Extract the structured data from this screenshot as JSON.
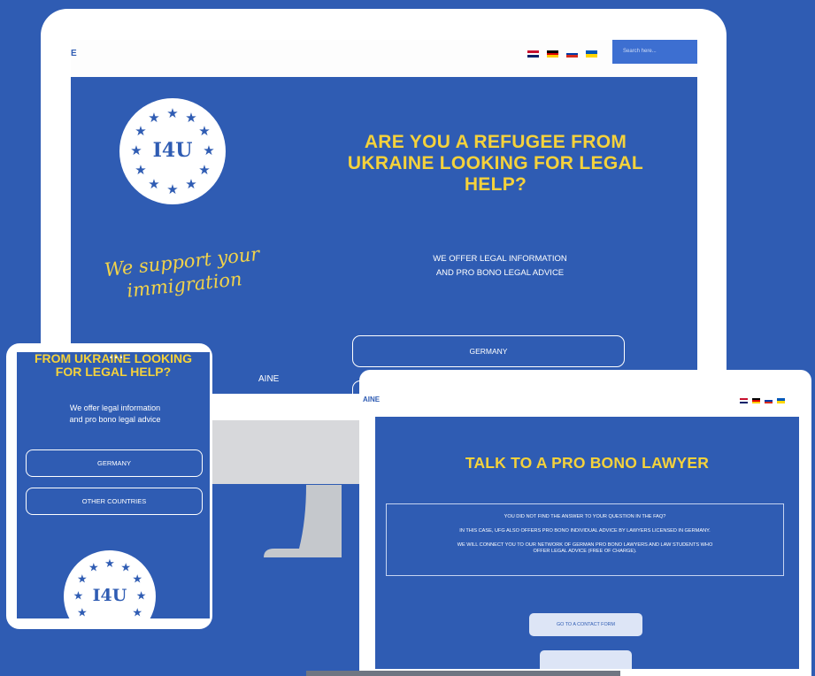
{
  "desktop": {
    "brand_cut": "E",
    "search": {
      "placeholder": "Search here..."
    },
    "flags": [
      "united-kingdom-flag",
      "germany-flag",
      "russia-flag",
      "ukraine-flag"
    ],
    "logo": {
      "text": "I4U"
    },
    "heading": "ARE YOU A REFUGEE FROM UKRAINE LOOKING FOR LEGAL HELP?",
    "script_text": "We support your immigration",
    "subheading_line1": "WE OFFER LEGAL INFORMATION",
    "subheading_line2": "AND PRO BONO LEGAL ADVICE",
    "button_germany": "GERMANY",
    "ukraine_cut": "AINE"
  },
  "tablet": {
    "dots": "•••",
    "heading_line1": "FROM UKRAINE LOOKING",
    "heading_line2": "FOR LEGAL HELP?",
    "sub_line1": "We offer legal information",
    "sub_line2": "and pro bono legal advice",
    "button_germany": "GERMANY",
    "button_other": "OTHER COUNTRIES",
    "logo_text": "I4U"
  },
  "laptop": {
    "brand_cut": "AINE",
    "flags": [
      "united-kingdom-flag",
      "germany-flag",
      "russia-flag",
      "ukraine-flag"
    ],
    "heading": "TALK TO A PRO BONO LAWYER",
    "box_line1": "YOU DID NOT FIND THE ANSWER TO YOUR QUESTION IN THE FAQ?",
    "box_line2": "IN THIS CASE, UFG ALSO OFFERS PRO BONO INDIVIDUAL ADVICE BY LAWYERS LICENSED IN GERMANY.",
    "box_line3": "WE WILL CONNECT YOU TO OUR NETWORK OF GERMAN PRO BONO LAWYERS AND LAW STUDENTS WHO OFFER LEGAL ADVICE (FREE OF CHARGE).",
    "contact_button": "GO TO A CONTACT FORM",
    "second_button": ""
  },
  "colors": {
    "background": "#2f5cb3",
    "accent_yellow": "#f5d23b",
    "white": "#ffffff"
  }
}
